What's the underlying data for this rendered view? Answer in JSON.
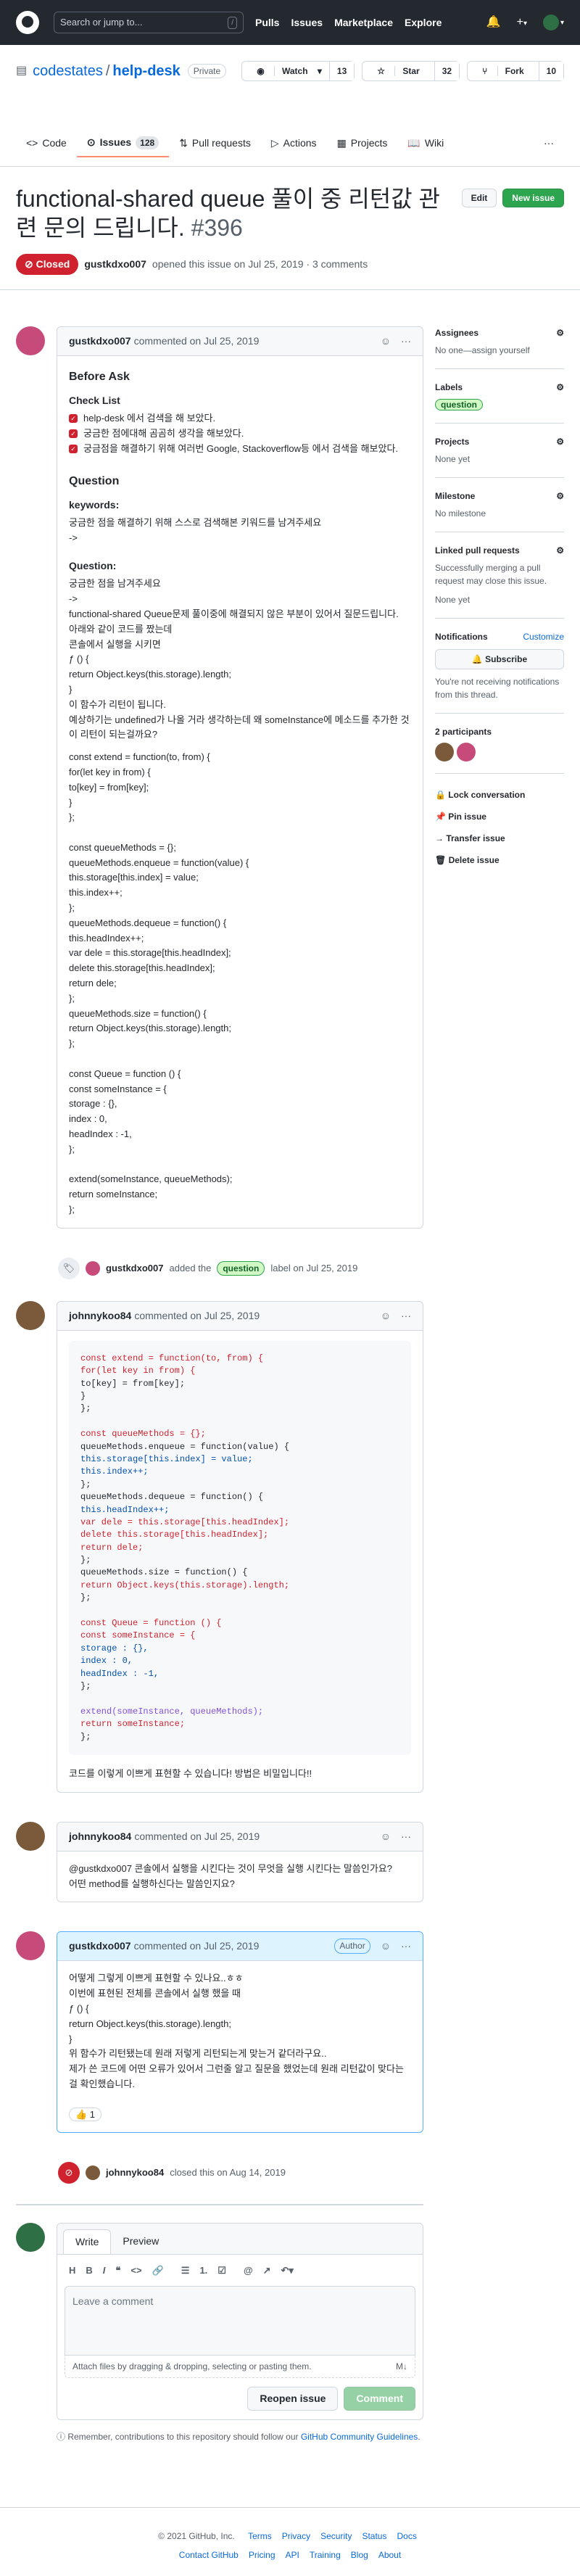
{
  "header": {
    "search_placeholder": "Search or jump to...",
    "slash": "/",
    "nav": [
      "Pulls",
      "Issues",
      "Marketplace",
      "Explore"
    ],
    "plus": "+",
    "caret": "▾"
  },
  "repo": {
    "owner": "codestates",
    "sep": "/",
    "name": "help-desk",
    "visibility": "Private",
    "watch": "Watch",
    "watch_count": "13",
    "star": "Star",
    "star_count": "32",
    "fork": "Fork",
    "fork_count": "10",
    "tabs": [
      {
        "label": "Code"
      },
      {
        "label": "Issues",
        "count": "128"
      },
      {
        "label": "Pull requests"
      },
      {
        "label": "Actions"
      },
      {
        "label": "Projects"
      },
      {
        "label": "Wiki"
      }
    ]
  },
  "issue": {
    "title": "functional-shared queue 풀이 중 리턴값 관련 문의 드립니다.",
    "number": "#396",
    "edit": "Edit",
    "new_issue": "New issue",
    "state": "Closed",
    "author": "gustkdxo007",
    "opened_text": "opened this issue on Jul 25, 2019 · 3 comments"
  },
  "c1": {
    "author": "gustkdxo007",
    "date": "commented on Jul 25, 2019",
    "h_before": "Before Ask",
    "h_check": "Check List",
    "checks": [
      "help-desk 에서 검색을 해 보았다.",
      "궁금한 점에대해 곰곰히 생각을 해보았다.",
      "궁금점을 해결하기 위해 여러번 Google, Stackoverflow등 에서 검색을 해보았다."
    ],
    "h_question": "Question",
    "h_keywords": "keywords:",
    "kw1": "궁금한 점을 해결하기 위해 스스로 검색해본 키워드를 남겨주세요",
    "arrow": "->",
    "h_question2": "Question:",
    "lines": [
      "궁금한 점을 남겨주세요",
      "->",
      "functional-shared Queue문제 풀이중에 해결되지 않은 부분이 있어서 질문드립니다.",
      "아래와 같이 코드를 짰는데",
      "콘솔에서 실행을 시키면",
      "ƒ () {",
      "return Object.keys(this.storage).length;",
      "}",
      "이 함수가 리턴이 됩니다.",
      "예상하기는 undefined가 나올 거라 생각하는데 왜 someInstance에 메소드를 추가한 것이 리턴이 되는걸까요?"
    ],
    "code": [
      "const extend = function(to, from) {",
      "for(let key in from) {",
      "to[key] = from[key];",
      "}",
      "};",
      "",
      "const queueMethods = {};",
      "queueMethods.enqueue = function(value) {",
      "this.storage[this.index] = value;",
      "this.index++;",
      "};",
      "queueMethods.dequeue = function() {",
      "this.headIndex++;",
      "var dele = this.storage[this.headIndex];",
      "delete this.storage[this.headIndex];",
      "return dele;",
      "};",
      "queueMethods.size = function() {",
      "return Object.keys(this.storage).length;",
      "};",
      "",
      "const Queue = function () {",
      "const someInstance = {",
      "storage : {},",
      "index : 0,",
      "headIndex : -1,",
      "};",
      "",
      "extend(someInstance, queueMethods);",
      "return someInstance;",
      "};"
    ]
  },
  "evt1": {
    "author": "gustkdxo007",
    "pre": "added the",
    "label": "question",
    "post": "label on Jul 25, 2019"
  },
  "c2": {
    "author": "johnnykoo84",
    "date": "commented on Jul 25, 2019",
    "after": "코드를 이렇게 이쁘게 표현할 수 있습니다! 방법은 비밀입니다!!"
  },
  "c3": {
    "author": "johnnykoo84",
    "date": "commented on Jul 25, 2019",
    "lines": [
      "@gustkdxo007 콘솔에서 실행을 시킨다는 것이 무엇을 실행 시킨다는 말씀인가요?",
      "어떤 method를 실행하신다는 말씀인지요?"
    ]
  },
  "c4": {
    "author": "gustkdxo007",
    "date": "commented on Jul 25, 2019",
    "role": "Author",
    "lines": [
      "어떻게 그렇게 이쁘게 표현할 수 있나요..ㅎㅎ",
      "이번에 표현된 전체를 콘솔에서 실행 했을 때",
      "ƒ () {",
      "return Object.keys(this.storage).length;",
      "}",
      "위 함수가 리턴됐는데 원래 저렇게 리턴되는게 맞는거 같더라구요..",
      "제가 쓴 코드에 어떤 오류가 있어서 그런줄 알고 질문을 했었는데 원래 리턴값이 맞다는 걸 확인했습니다."
    ],
    "reaction": "👍 1"
  },
  "evt2": {
    "author": "johnnykoo84",
    "text": "closed this on Aug 14, 2019"
  },
  "editor": {
    "write": "Write",
    "preview": "Preview",
    "tools": [
      "H",
      "B",
      "I",
      "❝",
      "<>",
      "🔗",
      "☰",
      "1.",
      "☑",
      "@",
      "↗",
      "↶▾"
    ],
    "placeholder": "Leave a comment",
    "attach": "Attach files by dragging & dropping, selecting or pasting them.",
    "reopen": "Reopen issue",
    "comment": "Comment",
    "note_pre": "Remember, contributions to this repository should follow our",
    "note_link": "GitHub Community Guidelines",
    "note_post": "."
  },
  "sidebar": {
    "assignees": "Assignees",
    "assignees_val": "No one—assign yourself",
    "labels": "Labels",
    "label": "question",
    "projects": "Projects",
    "projects_val": "None yet",
    "milestone": "Milestone",
    "milestone_val": "No milestone",
    "linked": "Linked pull requests",
    "linked_val": "Successfully merging a pull request may close this issue.",
    "linked_val2": "None yet",
    "notifications": "Notifications",
    "customize": "Customize",
    "subscribe": "Subscribe",
    "notif_val": "You're not receiving notifications from this thread.",
    "participants": "2 participants",
    "lock": "Lock conversation",
    "pin": "Pin issue",
    "transfer": "Transfer issue",
    "delete": "Delete issue"
  },
  "footer": {
    "copy": "© 2021 GitHub, Inc.",
    "links1": [
      "Terms",
      "Privacy",
      "Security",
      "Status",
      "Docs"
    ],
    "links2": [
      "Contact GitHub",
      "Pricing",
      "API",
      "Training",
      "Blog",
      "About"
    ]
  }
}
